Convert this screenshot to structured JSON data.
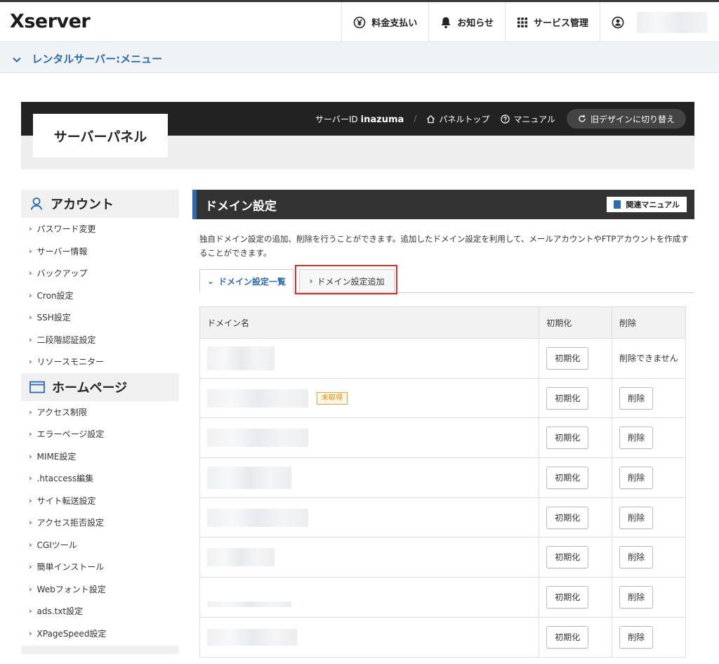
{
  "header": {
    "logo": "Xserver",
    "nav": [
      {
        "label": "料金支払い",
        "icon": "yen-icon"
      },
      {
        "label": "お知らせ",
        "icon": "bell-icon"
      },
      {
        "label": "サービス管理",
        "icon": "grid-icon"
      }
    ],
    "user_icon": "user-icon"
  },
  "menubar": {
    "label": "レンタルサーバー:メニュー"
  },
  "panel": {
    "title": "サーバーパネル",
    "server_id_label": "サーバーID",
    "server_id": "inazuma",
    "panel_top": "パネルトップ",
    "manual": "マニュアル",
    "old_design": "旧デザインに切り替え"
  },
  "sidebar": {
    "sections": [
      {
        "title": "アカウント",
        "icon": "person-icon",
        "items": [
          "パスワード変更",
          "サーバー情報",
          "バックアップ",
          "Cron設定",
          "SSH設定",
          "二段階認証設定",
          "リソースモニター"
        ]
      },
      {
        "title": "ホームページ",
        "icon": "window-icon",
        "items": [
          "アクセス制限",
          "エラーページ設定",
          "MIME設定",
          ".htaccess編集",
          "サイト転送設定",
          "アクセス拒否設定",
          "CGIツール",
          "簡単インストール",
          "Webフォント設定",
          "ads.txt設定",
          "XPageSpeed設定"
        ]
      }
    ]
  },
  "main": {
    "title": "ドメイン設定",
    "manual_button": "関連マニュアル",
    "description": "独自ドメイン設定の追加、削除を行うことができます。追加したドメイン設定を利用して、メールアカウントやFTPアカウントを作成することができます。",
    "tabs": [
      {
        "label": "ドメイン設定一覧",
        "active": true
      },
      {
        "label": "ドメイン設定追加",
        "active": false
      }
    ],
    "table": {
      "headers": [
        "ドメイン名",
        "初期化",
        "削除"
      ],
      "init_label": "初期化",
      "delete_label": "削除",
      "cannot_delete": "削除できません",
      "unacquired_badge": "未取得"
    }
  }
}
